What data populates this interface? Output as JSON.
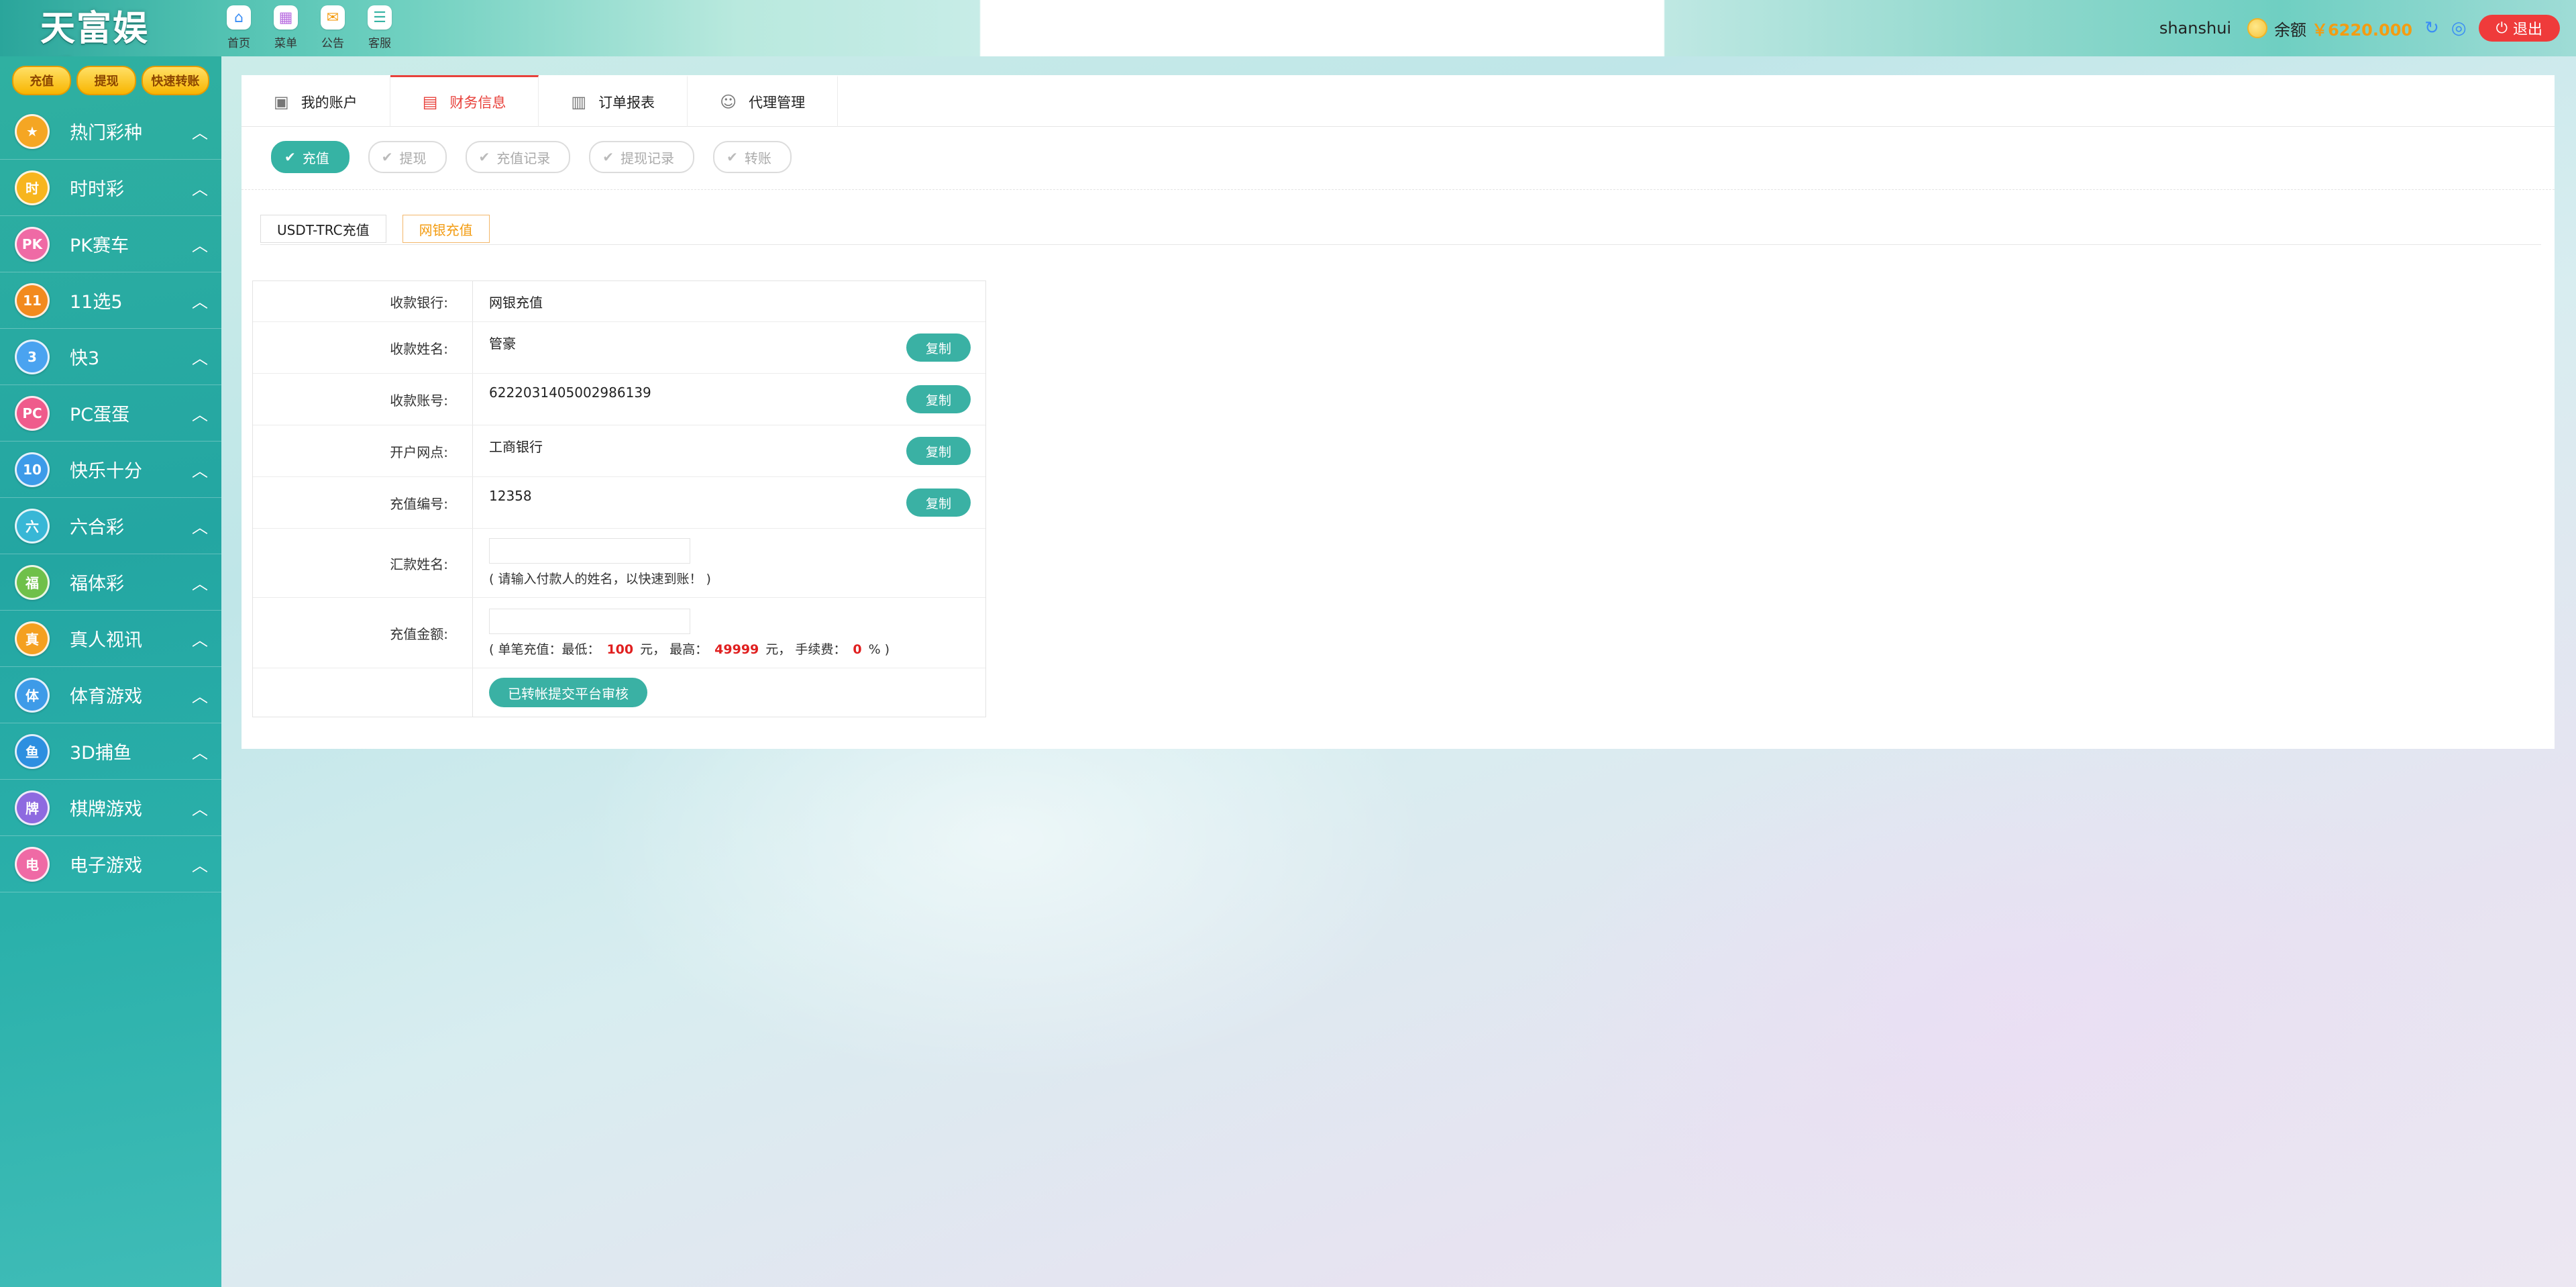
{
  "brand": {
    "logo_text": "天富娱乐",
    "mark": "®"
  },
  "topnav": [
    {
      "label": "首页",
      "icon": "home-icon"
    },
    {
      "label": "菜单",
      "icon": "grid-icon"
    },
    {
      "label": "公告",
      "icon": "megaphone-icon"
    },
    {
      "label": "客服",
      "icon": "chat-icon"
    }
  ],
  "user": {
    "username": "shanshui",
    "balance_label": "余额",
    "balance_value": "￥6220.000",
    "logout_label": "退出"
  },
  "quick_actions": [
    "充值",
    "提现",
    "快速转账"
  ],
  "sidebar": [
    {
      "label": "热门彩种",
      "icon": "hot-lottery-icon",
      "glyph": "★",
      "color": "#f5a623"
    },
    {
      "label": "时时彩",
      "icon": "ssc-icon",
      "glyph": "时",
      "color": "#f7b51e"
    },
    {
      "label": "PK赛车",
      "icon": "pk-racing-icon",
      "glyph": "PK",
      "color": "#ef6aa5"
    },
    {
      "label": "11选5",
      "icon": "eleven-five-icon",
      "glyph": "11",
      "color": "#f28a1e"
    },
    {
      "label": "快3",
      "icon": "k3-icon",
      "glyph": "3",
      "color": "#4aa3f0"
    },
    {
      "label": "PC蛋蛋",
      "icon": "pc-egg-icon",
      "glyph": "PC",
      "color": "#ef5b8c"
    },
    {
      "label": "快乐十分",
      "icon": "happy-ten-icon",
      "glyph": "10",
      "color": "#3d9be9"
    },
    {
      "label": "六合彩",
      "icon": "mark-six-icon",
      "glyph": "六",
      "color": "#38b7d6"
    },
    {
      "label": "福体彩",
      "icon": "welfare-lottery-icon",
      "glyph": "福",
      "color": "#6fc04a"
    },
    {
      "label": "真人视讯",
      "icon": "live-casino-icon",
      "glyph": "真",
      "color": "#f4a020"
    },
    {
      "label": "体育游戏",
      "icon": "sports-icon",
      "glyph": "体",
      "color": "#3e9be8"
    },
    {
      "label": "3D捕鱼",
      "icon": "fishing-icon",
      "glyph": "鱼",
      "color": "#2d8fe0"
    },
    {
      "label": "棋牌游戏",
      "icon": "chess-cards-icon",
      "glyph": "牌",
      "color": "#8e6ae0"
    },
    {
      "label": "电子游戏",
      "icon": "slots-icon",
      "glyph": "电",
      "color": "#ef6aa5"
    }
  ],
  "tabs": [
    {
      "label": "我的账户",
      "icon": "wallet-icon",
      "active": false
    },
    {
      "label": "财务信息",
      "icon": "finance-icon",
      "active": true
    },
    {
      "label": "订单报表",
      "icon": "report-icon",
      "active": false
    },
    {
      "label": "代理管理",
      "icon": "agent-icon",
      "active": false
    }
  ],
  "subtabs": [
    {
      "label": "充值",
      "active": true
    },
    {
      "label": "提现",
      "active": false
    },
    {
      "label": "充值记录",
      "active": false
    },
    {
      "label": "提现记录",
      "active": false
    },
    {
      "label": "转账",
      "active": false
    }
  ],
  "pay_methods": [
    {
      "label": "USDT-TRC充值",
      "active": false
    },
    {
      "label": "网银充值",
      "active": true
    }
  ],
  "form": {
    "bank_label": "收款银行:",
    "bank_value": "网银充值",
    "name_label": "收款姓名:",
    "name_value": "管豪",
    "account_label": "收款账号:",
    "account_value": "6222031405002986139",
    "branch_label": "开户网点:",
    "branch_value": "工商银行",
    "code_label": "充值编号:",
    "code_value": "12358",
    "payer_label": "汇款姓名:",
    "payer_value": "",
    "payer_hint": "( 请输入付款人的姓名，以快速到账！ )",
    "amount_label": "充值金额:",
    "amount_value": "",
    "limit_prefix": "( 单笔充值：最低：",
    "min": "100",
    "limit_mid1": "元，  最高：",
    "max": "49999",
    "limit_mid2": "元，  手续费：",
    "fee": "0",
    "limit_suffix": "% )",
    "copy_label": "复制",
    "submit_label": "已转帐提交平台审核"
  }
}
